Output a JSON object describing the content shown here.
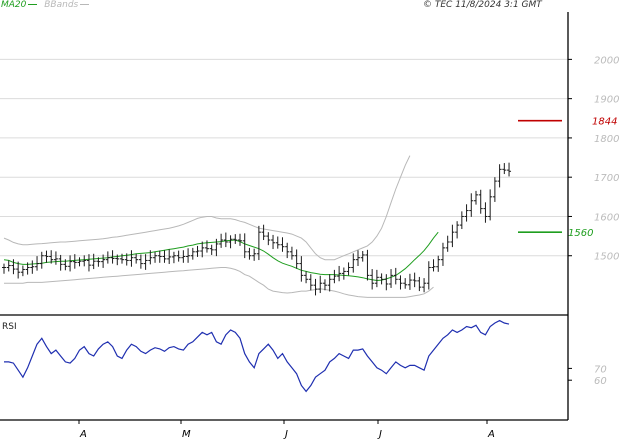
{
  "header": {
    "ma_label": "MA20",
    "bb_label": "BBands",
    "credit": "© TEC 11/8/2024 3:1 GMT"
  },
  "rsi_panel": {
    "label": "RSI"
  },
  "colors": {
    "price_bars": "#1a1a1a",
    "ma": "#1f9e1f",
    "bbands": "#b8b8b8",
    "rsi": "#1f2fb0",
    "resistance": "#c00000",
    "support": "#1f9e1f",
    "grid": "#dcdcdc"
  },
  "chart_data": [
    {
      "type": "ohlc",
      "series": [
        {
          "name": "MA20"
        },
        {
          "name": "BBands"
        }
      ],
      "x_tick_labels": [
        "A",
        "M",
        "J",
        "J",
        "A"
      ],
      "y_tick_labels": [
        "2000",
        "1900",
        "1800",
        "1700",
        "1600",
        "1500"
      ],
      "ylim": [
        1400,
        2100
      ],
      "grid": true,
      "levels": [
        {
          "label": "1844",
          "value": 1844,
          "color": "#c00000"
        },
        {
          "label": "1560",
          "value": 1560,
          "color": "#1f9e1f"
        }
      ],
      "close": [
        1470,
        1475,
        1466,
        1458,
        1465,
        1470,
        1472,
        1480,
        1500,
        1498,
        1490,
        1492,
        1478,
        1473,
        1485,
        1483,
        1486,
        1488,
        1476,
        1486,
        1485,
        1490,
        1495,
        1493,
        1492,
        1490,
        1488,
        1495,
        1490,
        1480,
        1488,
        1495,
        1500,
        1498,
        1492,
        1497,
        1500,
        1495,
        1498,
        1500,
        1510,
        1512,
        1520,
        1518,
        1515,
        1530,
        1540,
        1535,
        1542,
        1540,
        1538,
        1510,
        1500,
        1505,
        1560,
        1550,
        1540,
        1533,
        1528,
        1523,
        1510,
        1500,
        1480,
        1450,
        1440,
        1425,
        1415,
        1430,
        1425,
        1440,
        1448,
        1455,
        1460,
        1470,
        1490,
        1495,
        1502,
        1450,
        1430,
        1445,
        1440,
        1428,
        1450,
        1440,
        1430,
        1426,
        1438,
        1436,
        1420,
        1430,
        1470,
        1472,
        1490,
        1520,
        1535,
        1560,
        1578,
        1600,
        1615,
        1640,
        1655,
        1620,
        1600,
        1650,
        1690,
        1720,
        1718,
        1715
      ],
      "ma20": [
        1490,
        1488,
        1483,
        1480,
        1478,
        1478,
        1479,
        1480,
        1481,
        1483,
        1484,
        1485,
        1486,
        1486,
        1487,
        1488,
        1489,
        1490,
        1491,
        1492,
        1493,
        1494,
        1495,
        1497,
        1498,
        1500,
        1501,
        1503,
        1505,
        1506,
        1507,
        1508,
        1510,
        1512,
        1514,
        1516,
        1518,
        1520,
        1522,
        1525,
        1527,
        1530,
        1532,
        1533,
        1534,
        1535,
        1536,
        1538,
        1539,
        1540,
        1536,
        1530,
        1526,
        1522,
        1518,
        1512,
        1504,
        1495,
        1487,
        1481,
        1477,
        1473,
        1468,
        1463,
        1460,
        1457,
        1455,
        1453,
        1452,
        1452,
        1452,
        1451,
        1450,
        1449,
        1448,
        1446,
        1444,
        1441,
        1439,
        1437,
        1438,
        1441,
        1445,
        1450,
        1458,
        1467,
        1478,
        1490,
        1501,
        1513,
        1528,
        1545,
        1560
      ],
      "bb_upper": [
        1545,
        1540,
        1534,
        1530,
        1528,
        1528,
        1529,
        1530,
        1531,
        1532,
        1533,
        1534,
        1535,
        1535,
        1536,
        1537,
        1538,
        1539,
        1540,
        1541,
        1542,
        1543,
        1545,
        1547,
        1548,
        1550,
        1552,
        1554,
        1556,
        1558,
        1560,
        1562,
        1564,
        1566,
        1568,
        1570,
        1573,
        1576,
        1580,
        1585,
        1590,
        1595,
        1598,
        1600,
        1600,
        1596,
        1594,
        1594,
        1594,
        1592,
        1588,
        1585,
        1580,
        1575,
        1570,
        1568,
        1566,
        1564,
        1562,
        1560,
        1558,
        1555,
        1550,
        1545,
        1535,
        1520,
        1505,
        1495,
        1490,
        1490,
        1490,
        1495,
        1500,
        1505,
        1510,
        1515,
        1520,
        1525,
        1535,
        1550,
        1570,
        1600,
        1635,
        1670,
        1700,
        1730,
        1755
      ],
      "bb_lower": [
        1430,
        1430,
        1430,
        1430,
        1430,
        1432,
        1432,
        1432,
        1432,
        1433,
        1434,
        1435,
        1436,
        1437,
        1438,
        1439,
        1440,
        1441,
        1442,
        1443,
        1444,
        1445,
        1446,
        1447,
        1448,
        1449,
        1450,
        1451,
        1452,
        1453,
        1454,
        1455,
        1456,
        1457,
        1458,
        1459,
        1460,
        1461,
        1462,
        1463,
        1464,
        1465,
        1466,
        1467,
        1468,
        1469,
        1470,
        1470,
        1468,
        1465,
        1460,
        1452,
        1448,
        1440,
        1432,
        1425,
        1415,
        1410,
        1408,
        1406,
        1405,
        1406,
        1408,
        1410,
        1410,
        1412,
        1414,
        1416,
        1414,
        1412,
        1410,
        1407,
        1403,
        1400,
        1398,
        1396,
        1395,
        1394,
        1394,
        1394,
        1394,
        1394,
        1394,
        1394,
        1394,
        1394,
        1396,
        1398,
        1400,
        1403,
        1410,
        1420
      ]
    },
    {
      "type": "line",
      "series": [
        {
          "name": "RSI"
        }
      ],
      "y_tick_labels": [
        "70",
        "60"
      ],
      "ylim": [
        0,
        100
      ],
      "values": [
        45,
        45,
        44,
        38,
        32,
        40,
        50,
        60,
        65,
        58,
        52,
        55,
        50,
        45,
        44,
        48,
        55,
        58,
        52,
        50,
        56,
        60,
        62,
        58,
        50,
        48,
        55,
        60,
        58,
        54,
        52,
        55,
        57,
        56,
        54,
        57,
        58,
        56,
        55,
        60,
        62,
        66,
        70,
        68,
        70,
        62,
        60,
        68,
        72,
        70,
        65,
        52,
        45,
        40,
        52,
        56,
        60,
        55,
        48,
        52,
        45,
        40,
        35,
        25,
        20,
        25,
        32,
        35,
        38,
        45,
        48,
        52,
        50,
        48,
        55,
        55,
        56,
        50,
        45,
        40,
        38,
        35,
        40,
        45,
        42,
        40,
        42,
        42,
        40,
        38,
        50,
        55,
        60,
        65,
        68,
        72,
        70,
        72,
        75,
        74,
        76,
        70,
        68,
        75,
        78,
        80,
        78,
        77
      ]
    }
  ]
}
